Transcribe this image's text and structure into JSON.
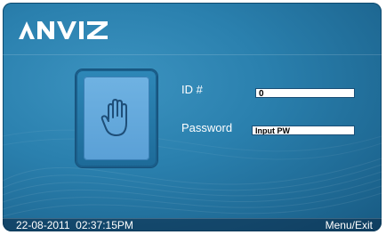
{
  "brand": {
    "logo_text": "ANVIZ"
  },
  "login": {
    "id_label": "ID #",
    "id_value": "0",
    "password_label": "Password",
    "password_value": "Input PW"
  },
  "status_bar": {
    "datetime": "22-08-2011  02:37:15PM",
    "menu_label": "Menu/Exit"
  },
  "icons": {
    "fingerprint_panel": "hand-icon"
  },
  "colors": {
    "background": "#2a80ae",
    "panel": "#5aa0d6",
    "text": "#ffffff",
    "field_bg": "#ffffff"
  }
}
